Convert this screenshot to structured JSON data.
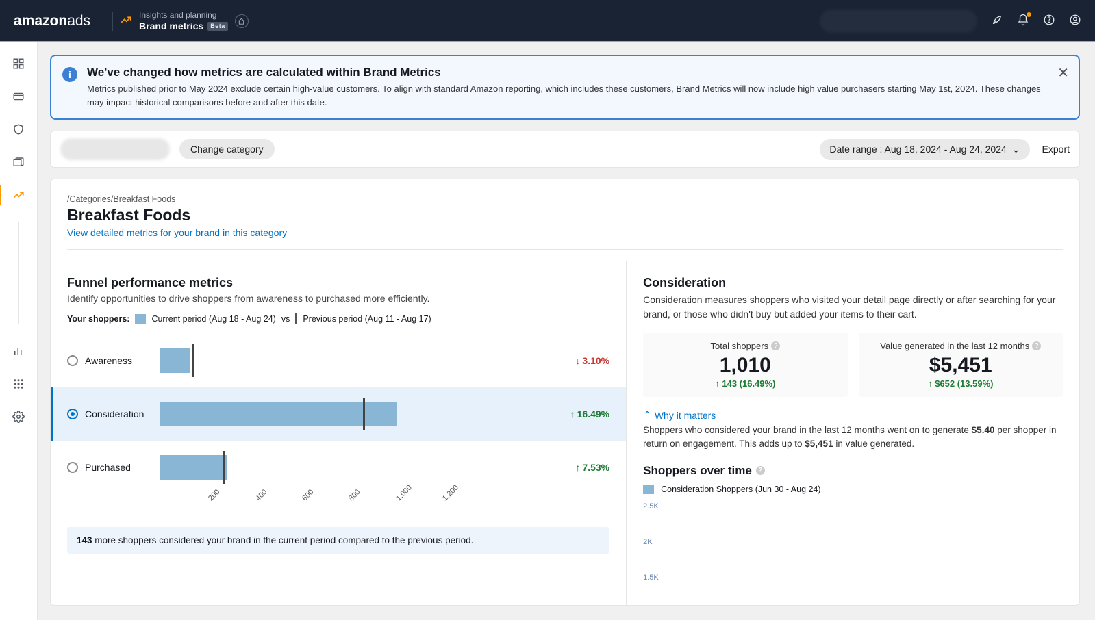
{
  "header": {
    "logo_main": "amazon",
    "logo_suffix": "ads",
    "breadcrumb_top": "Insights and planning",
    "breadcrumb_page": "Brand metrics",
    "beta": "Beta"
  },
  "banner": {
    "title": "We've changed how metrics are calculated within Brand Metrics",
    "body": "Metrics published prior to May 2024 exclude certain high-value customers. To align with standard Amazon reporting, which includes these customers, Brand Metrics will now include high value purchasers starting May 1st, 2024. These changes may impact historical comparisons before and after this date."
  },
  "toolbar": {
    "change_category": "Change category",
    "date_range": "Date range : Aug 18, 2024 - Aug 24, 2024",
    "export": "Export"
  },
  "page": {
    "crumb": "/Categories/Breakfast Foods",
    "title": "Breakfast Foods",
    "detail_link": "View detailed metrics for your brand in this category"
  },
  "funnel": {
    "title": "Funnel performance metrics",
    "subtitle": "Identify opportunities to drive shoppers from awareness to purchased more efficiently.",
    "legend_label": "Your shoppers:",
    "current_label": "Current period (Aug 18 - Aug 24)",
    "vs": "vs",
    "previous_label": "Previous period (Aug 11 - Aug 17)",
    "rows": {
      "awareness": {
        "label": "Awareness",
        "delta": "3.10%",
        "direction": "down"
      },
      "consideration": {
        "label": "Consideration",
        "delta": "16.49%",
        "direction": "up"
      },
      "purchased": {
        "label": "Purchased",
        "delta": "7.53%",
        "direction": "up"
      }
    },
    "summary_prefix": "143",
    "summary_rest": " more shoppers considered your brand in the current period compared to the previous period."
  },
  "chart_data": {
    "type": "bar",
    "title": "Funnel performance metrics",
    "xlabel": "",
    "ylabel": "Shoppers",
    "xlim": [
      0,
      1200
    ],
    "ticks": [
      "200",
      "400",
      "600",
      "800",
      "1,000",
      "1,200"
    ],
    "series": [
      {
        "name": "Current period (Aug 18 - Aug 24)",
        "categories": [
          "Awareness",
          "Consideration",
          "Purchased"
        ],
        "values": [
          130,
          1010,
          285
        ]
      },
      {
        "name": "Previous period (Aug 11 - Aug 17)",
        "categories": [
          "Awareness",
          "Consideration",
          "Purchased"
        ],
        "values": [
          134,
          867,
          265
        ]
      }
    ]
  },
  "right": {
    "title": "Consideration",
    "desc": "Consideration measures shoppers who visited your detail page directly or after searching for your brand, or those who didn't buy but added your items to their cart.",
    "kpi1": {
      "label": "Total shoppers",
      "value": "1,010",
      "delta": "143 (16.49%)"
    },
    "kpi2": {
      "label": "Value generated in the last 12 months",
      "value": "$5,451",
      "delta": "$652 (13.59%)"
    },
    "why_label": "Why it matters",
    "why_text_1": "Shoppers who considered your brand in the last 12 months went on to generate ",
    "why_bold_1": "$5.40",
    "why_text_2": " per shopper in return on engagement. This adds up to ",
    "why_bold_2": "$5,451",
    "why_text_3": " in value generated.",
    "sot_title": "Shoppers over time",
    "sot_legend": "Consideration Shoppers (Jun 30 - Aug 24)",
    "yaxis": {
      "y1": "2.5K",
      "y2": "2K",
      "y3": "1.5K"
    }
  }
}
